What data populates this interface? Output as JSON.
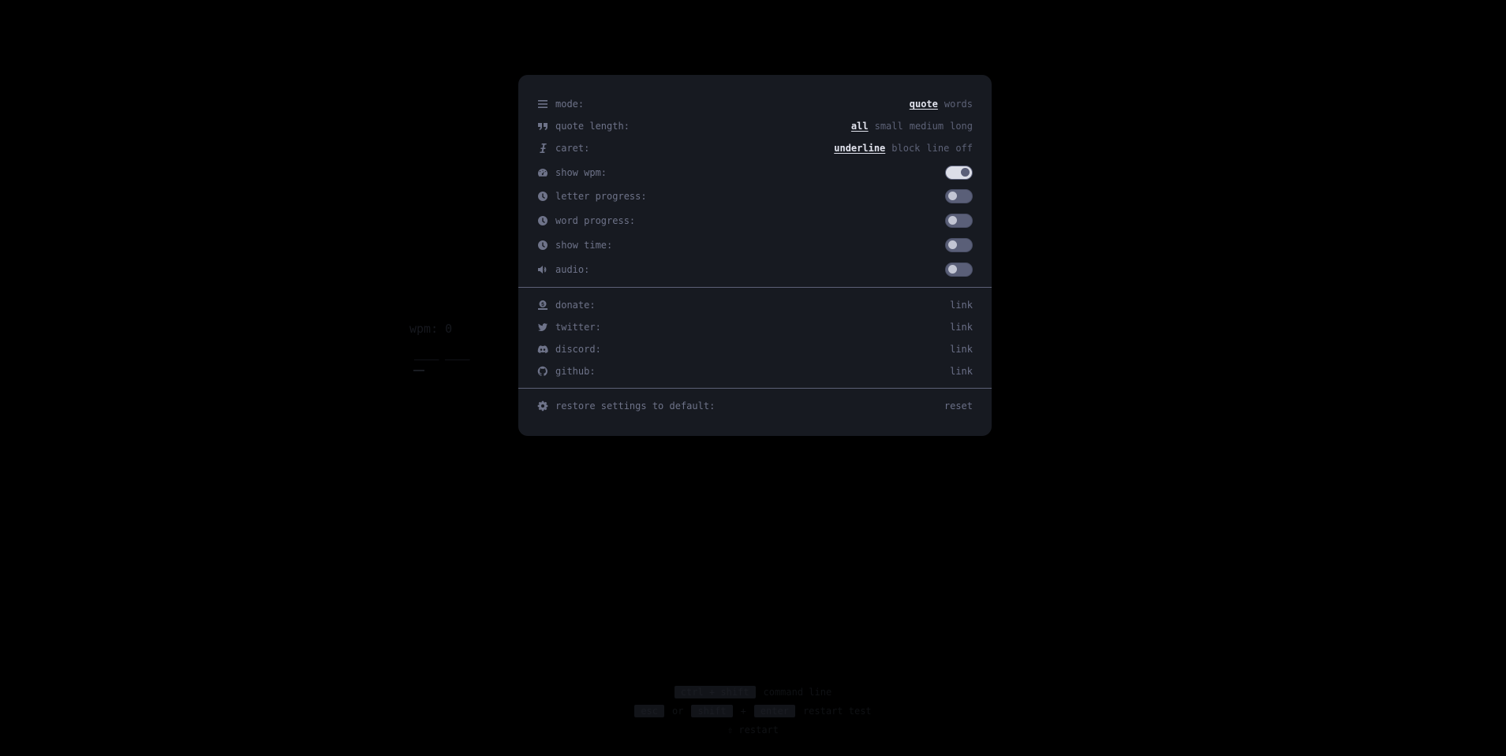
{
  "background": {
    "wpm_label": "wpm: 0",
    "words_preview": "──── ────",
    "hints": {
      "row1_key": "ctrl + shift",
      "row1_text": "command line",
      "row2_key1": "esc",
      "row2_or": "or",
      "row2_key2": "shift",
      "row2_plus": "+",
      "row2_key3": "enter",
      "row2_text": "restart test",
      "row3_text": "⇧ restart"
    }
  },
  "settings": {
    "mode": {
      "label": "mode:",
      "options": [
        "quote",
        "words"
      ],
      "selected": "quote"
    },
    "quote_length": {
      "label": "quote length:",
      "options": [
        "all",
        "small",
        "medium",
        "long"
      ],
      "selected": "all"
    },
    "caret": {
      "label": "caret:",
      "options": [
        "underline",
        "block",
        "line",
        "off"
      ],
      "selected": "underline"
    },
    "show_wpm": {
      "label": "show wpm:",
      "on": true
    },
    "letter_progress": {
      "label": "letter progress:",
      "on": false
    },
    "word_progress": {
      "label": "word progress:",
      "on": false
    },
    "show_time": {
      "label": "show time:",
      "on": false
    },
    "audio": {
      "label": "audio:",
      "on": false
    }
  },
  "links": {
    "donate": {
      "label": "donate:",
      "value": "link"
    },
    "twitter": {
      "label": "twitter:",
      "value": "link"
    },
    "discord": {
      "label": "discord:",
      "value": "link"
    },
    "github": {
      "label": "github:",
      "value": "link"
    }
  },
  "restore": {
    "label": "restore settings to default:",
    "action": "reset"
  },
  "colors": {
    "modal_bg": "#171a21",
    "text": "#6e7389",
    "active": "#e2e4ee",
    "toggle_track": "#5a5f78"
  },
  "icons": {
    "mode": "list-icon",
    "quote_length": "quote-icon",
    "caret": "i-cursor-icon",
    "show_wpm": "speedometer-icon",
    "letter_progress": "clock-icon",
    "word_progress": "clock-icon",
    "show_time": "clock-icon",
    "audio": "volume-icon",
    "donate": "donate-icon",
    "twitter": "twitter-icon",
    "discord": "discord-icon",
    "github": "github-icon",
    "restore": "gear-icon"
  }
}
